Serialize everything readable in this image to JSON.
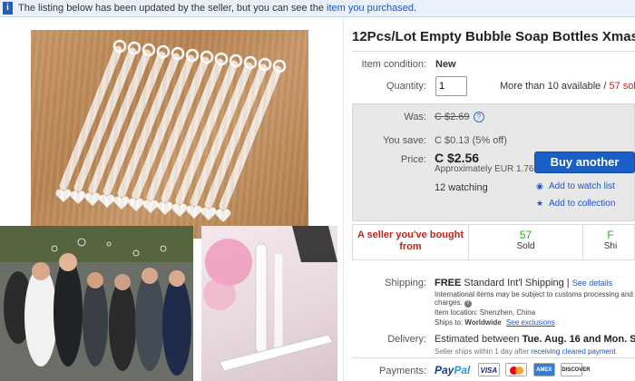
{
  "notice": {
    "text": "The listing below has been updated by the seller, but you can see the",
    "link": "item you purchased",
    "suffix": "."
  },
  "listing": {
    "title": "12Pcs/Lot Empty Bubble Soap Bottles Xmas We",
    "condition_label": "Item condition:",
    "condition_value": "New",
    "quantity_label": "Quantity:",
    "quantity_value": "1",
    "available_text": "More than 10 available /",
    "sold_text": "57 sold"
  },
  "pricing": {
    "was_label": "Was:",
    "was_value": "C $2.69",
    "save_label": "You save:",
    "save_value": "C $0.13 (5% off)",
    "price_label": "Price:",
    "price_value": "C $2.56",
    "approx_value": "Approximately EUR 1.76",
    "watching": "12 watching",
    "buy_label": "Buy another",
    "watch_label": "Add to watch list",
    "collection_label": "Add to collection"
  },
  "seller": {
    "note_line1": "A seller you've bought",
    "note_line2": "from",
    "stat1_value": "57",
    "stat1_label": "Sold",
    "stat2_value": "F",
    "stat2_label": "Shi"
  },
  "shipping": {
    "label": "Shipping:",
    "free": "FREE",
    "method": "Standard Int'l Shipping |",
    "details_link": "See details",
    "note_line1": "International items may be subject to customs processing and",
    "note_line2": "charges.",
    "location": "Item location:  Shenzhen, China",
    "ships_to_prefix": "Ships to:",
    "ships_to_value": "Worldwide",
    "exclusions_link": "See exclusions"
  },
  "delivery": {
    "label": "Delivery:",
    "prefix": "Estimated between",
    "dates": "Tue. Aug. 16 and Mon. Sep.",
    "note_prefix": "Seller ships within 1 day after",
    "note_link": "receiving cleared payment",
    "note_suffix": "."
  },
  "payments": {
    "label": "Payments:",
    "paypal_p1": "Pay",
    "paypal_p2": "Pal",
    "visa": "VISA",
    "amex": "AMEX",
    "discover": "DISCOVER"
  },
  "colors": {
    "accent": "#1a5fc7",
    "link": "#1c55c8",
    "sold_red": "#c5231e",
    "stat_green": "#34a53a"
  }
}
